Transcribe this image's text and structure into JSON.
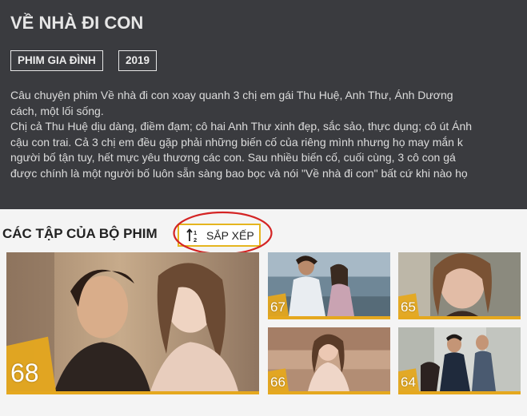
{
  "movie": {
    "title": "VỀ NHÀ ĐI CON",
    "genre": "PHIM GIA ĐÌNH",
    "year": "2019",
    "description_lines": [
      "Câu chuyện phim Về nhà đi con xoay quanh 3 chị em gái Thu Huệ, Anh Thư, Ánh Dương",
      "cách, một lối sống.",
      "Chị cả Thu Huệ dịu dàng, điềm đạm; cô hai Anh Thư xinh đẹp, sắc sảo, thực dụng; cô út Ánh",
      "cậu con trai. Cả 3 chị em đều gặp phải những biến cố của riêng mình nhưng họ may mắn k",
      "người bố tận tuy, hết mực yêu thương các con. Sau nhiều biến cố, cuối cùng, 3 cô con gá",
      "được chính là một người bố luôn sẵn sàng bao bọc và nói \"Về nhà đi con\" bất cứ khi nào họ"
    ]
  },
  "episodes_section": {
    "title": "CÁC TẬP CỦA BỘ PHIM",
    "sort_label": "SẮP XẾP",
    "sort_icon": "sort-arrows-12-icon",
    "highlight_color": "#e5b51f",
    "episodes": [
      {
        "number": "68",
        "scene": "two-women-argument"
      },
      {
        "number": "67",
        "scene": "couple-by-sea"
      },
      {
        "number": "65",
        "scene": "woman-closeup"
      },
      {
        "number": "66",
        "scene": "woman-bedroom"
      },
      {
        "number": "64",
        "scene": "people-hallway"
      }
    ]
  }
}
